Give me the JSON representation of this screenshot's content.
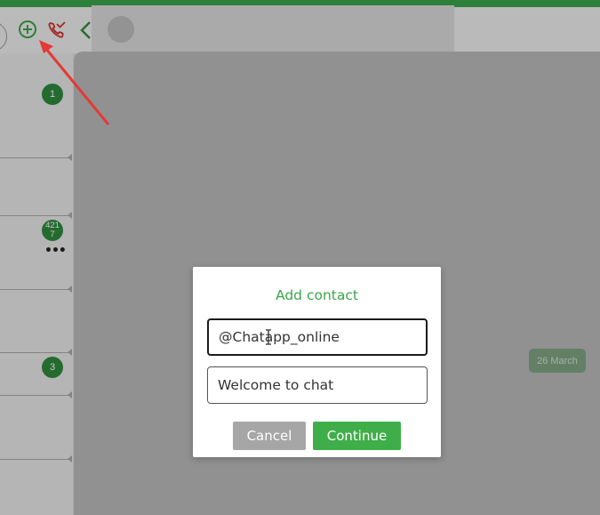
{
  "header": {
    "icons": [
      "add-contact-icon",
      "missed-call-icon",
      "back-chevron-icon"
    ]
  },
  "sidebar": {
    "badges": [
      "1",
      "421\n7",
      "3"
    ],
    "more_label": "•••"
  },
  "chat": {
    "date_label": "26 March"
  },
  "modal": {
    "title": "Add contact",
    "username_value": "@Chatapp_online",
    "message_value": "Welcome to chat",
    "cancel_label": "Cancel",
    "continue_label": "Continue"
  },
  "colors": {
    "accent": "#3aa54a",
    "badge": "#2f8a3d",
    "arrow": "#e53935",
    "cancel": "#a6a6a6"
  }
}
